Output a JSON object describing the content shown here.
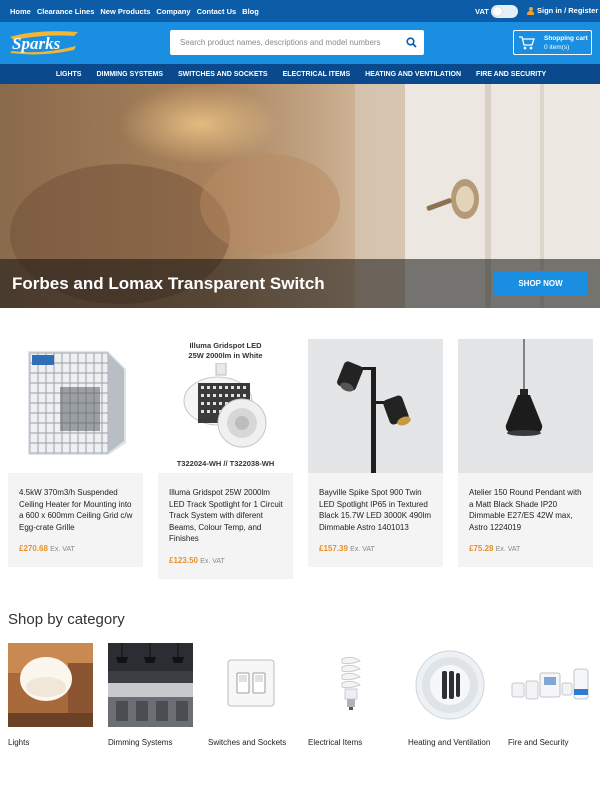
{
  "topbar": {
    "links": [
      "Home",
      "Clearance Lines",
      "New Products",
      "Company",
      "Contact Us",
      "Blog"
    ],
    "vat_label": "VAT",
    "signin_label": "Sign in / Register"
  },
  "header": {
    "logo_text": "Sparks",
    "search_placeholder": "Search product names, descriptions and model numbers",
    "cart_title": "Shopping cart",
    "cart_count": "0 item(s)"
  },
  "nav": {
    "items": [
      "LIGHTS",
      "DIMMING SYSTEMS",
      "SWITCHES AND SOCKETS",
      "ELECTRICAL ITEMS",
      "HEATING AND VENTILATION",
      "FIRE AND SECURITY"
    ]
  },
  "hero": {
    "title": "Forbes and Lomax Transparent Switch",
    "button_label": "SHOP NOW"
  },
  "products": [
    {
      "name": "4.5kW 370m3/h Suspended Ceiling Heater for Mounting into a 600 x 600mm Ceiling Grid c/w Egg-crate Grille",
      "price": "£270.68",
      "vat": "Ex. VAT"
    },
    {
      "name": "Illuma Gridspot 25W 2000lm LED Track Spotlight for 1 Circuit Track System with diferent Beams, Colour Temp, and Finishes",
      "price": "£123.50",
      "vat": "Ex. VAT",
      "image_caption_top_1": "Illuma Gridspot LED",
      "image_caption_top_2": "25W 2000lm in White",
      "image_caption_bottom": "T322024-WH // T322038-WH"
    },
    {
      "name": "Bayville Spike Spot 900 Twin LED Spotlight IP65 in Textured Black 15.7W LED 3000K 490lm Dimmable Astro 1401013",
      "price": "£157.39",
      "vat": "Ex. VAT"
    },
    {
      "name": "Atelier 150 Round Pendant with a Matt Black Shade IP20 Dimmable E27/ES 42W max, Astro 1224019",
      "price": "£75.28",
      "vat": "Ex. VAT"
    }
  ],
  "categories_heading": "Shop by category",
  "categories": [
    "Lights",
    "Dimming Systems",
    "Switches and Sockets",
    "Electrical Items",
    "Heating and Ventilation",
    "Fire and Security"
  ],
  "colors": {
    "topbar": "#0c5ca8",
    "header": "#1a8ee0",
    "nav": "#0a4a8c",
    "price": "#e8902a",
    "button": "#1a8ee0"
  }
}
